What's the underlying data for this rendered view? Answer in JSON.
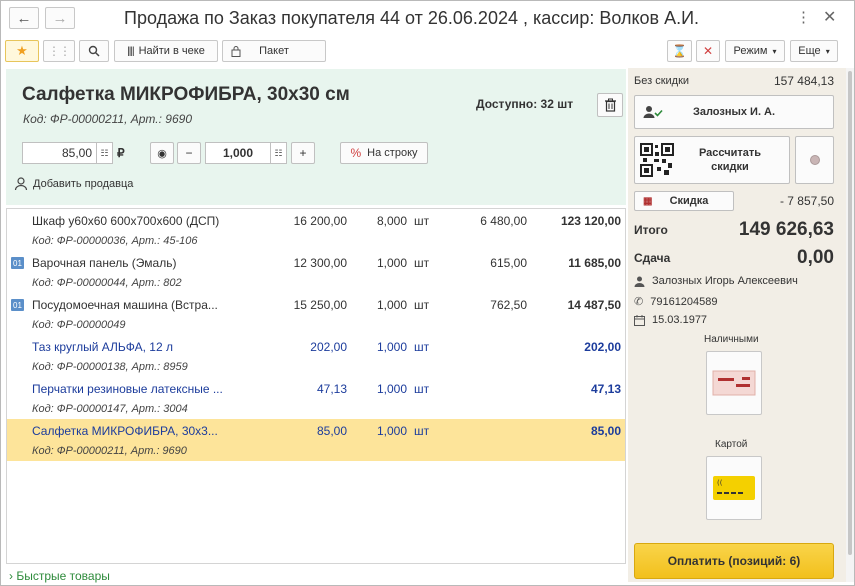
{
  "window": {
    "title": "Продажа по Заказ покупателя 44 от 26.06.2024 , кассир: Волков А.И."
  },
  "toolbar": {
    "find_label": "Найти в чеке",
    "package_label": "Пакет",
    "mode_label": "Режим",
    "more_label": "Еще"
  },
  "product": {
    "name": "Салфетка МИКРОФИБРА, 30х30 см",
    "code": "Код: ФР-00000211, Арт.: 9690",
    "available": "Доступно: 32 шт",
    "price": "85,00",
    "currency": "₽",
    "quantity": "1,000",
    "to_row_label": "На строку",
    "add_seller_label": "Добавить продавца"
  },
  "rows": [
    {
      "name": "Шкаф у60х60 600х700х600 (ДСП)",
      "code": "Код: ФР-00000036, Арт.: 45-106",
      "price": "16 200,00",
      "qty": "8,000",
      "unit": "шт",
      "discount": "6 480,00",
      "sum": "123 120,00",
      "badge": ""
    },
    {
      "name": "Варочная панель (Эмаль)",
      "code": "Код: ФР-00000044, Арт.: 802",
      "price": "12 300,00",
      "qty": "1,000",
      "unit": "шт",
      "discount": "615,00",
      "sum": "11 685,00",
      "badge": "01"
    },
    {
      "name": "Посудомоечная машина (Встра...",
      "code": "Код: ФР-00000049",
      "price": "15 250,00",
      "qty": "1,000",
      "unit": "шт",
      "discount": "762,50",
      "sum": "14 487,50",
      "badge": "01"
    },
    {
      "name": "Таз круглый АЛЬФА, 12 л",
      "code": "Код: ФР-00000138, Арт.: 8959",
      "price": "202,00",
      "qty": "1,000",
      "unit": "шт",
      "discount": "",
      "sum": "202,00",
      "badge": ""
    },
    {
      "name": "Перчатки резиновые латексные ...",
      "code": "Код: ФР-00000147, Арт.: 3004",
      "price": "47,13",
      "qty": "1,000",
      "unit": "шт",
      "discount": "",
      "sum": "47,13",
      "badge": ""
    },
    {
      "name": "Салфетка МИКРОФИБРА, 30х3...",
      "code": "Код: ФР-00000211, Арт.: 9690",
      "price": "85,00",
      "qty": "1,000",
      "unit": "шт",
      "discount": "",
      "sum": "85,00",
      "badge": ""
    }
  ],
  "quick_goods": "Быстрые товары",
  "summary": {
    "no_discount_label": "Без скидки",
    "no_discount_value": "157 484,13",
    "customer_button": "Залозных И. А.",
    "calc_discounts": "Рассчитать скидки",
    "discount_label": "Скидка",
    "discount_value": "- 7 857,50",
    "total_label": "Итого",
    "total_value": "149 626,63",
    "change_label": "Сдача",
    "change_value": "0,00",
    "customer_name": "Залозных Игорь Алексеевич",
    "phone": "79161204589",
    "birth_date": "15.03.1977",
    "cash_label": "Наличными",
    "card_label": "Картой",
    "pay_label": "Оплатить (позиций: 6)"
  }
}
